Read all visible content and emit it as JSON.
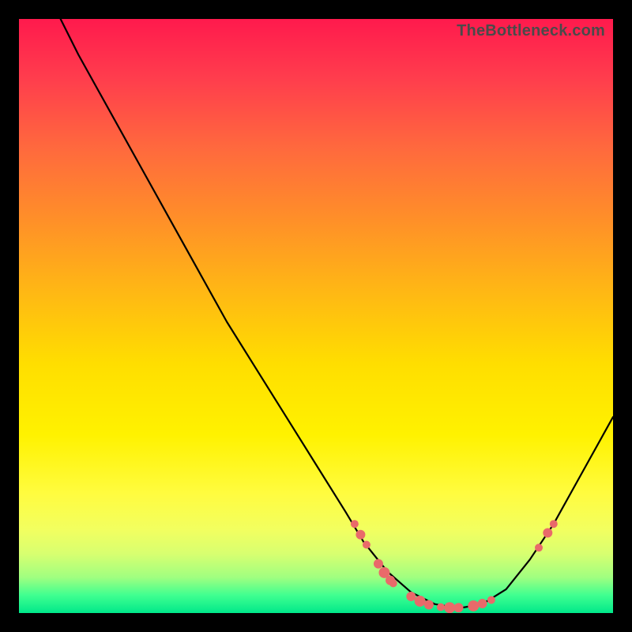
{
  "watermark": "TheBottleneck.com",
  "chart_data": {
    "type": "line",
    "title": "",
    "xlabel": "",
    "ylabel": "",
    "xlim": [
      0,
      100
    ],
    "ylim": [
      0,
      100
    ],
    "grid": false,
    "curve": [
      {
        "x": 7,
        "y": 100
      },
      {
        "x": 10,
        "y": 94
      },
      {
        "x": 15,
        "y": 85
      },
      {
        "x": 20,
        "y": 76
      },
      {
        "x": 25,
        "y": 67
      },
      {
        "x": 30,
        "y": 58
      },
      {
        "x": 35,
        "y": 49
      },
      {
        "x": 40,
        "y": 41
      },
      {
        "x": 45,
        "y": 33
      },
      {
        "x": 50,
        "y": 25
      },
      {
        "x": 55,
        "y": 17
      },
      {
        "x": 58,
        "y": 12
      },
      {
        "x": 62,
        "y": 7
      },
      {
        "x": 66,
        "y": 3.5
      },
      {
        "x": 70,
        "y": 1.5
      },
      {
        "x": 74,
        "y": 0.8
      },
      {
        "x": 78,
        "y": 1.5
      },
      {
        "x": 82,
        "y": 4
      },
      {
        "x": 86,
        "y": 9
      },
      {
        "x": 90,
        "y": 15
      },
      {
        "x": 95,
        "y": 24
      },
      {
        "x": 100,
        "y": 33
      }
    ],
    "markers": [
      {
        "x": 56.5,
        "y": 15.0,
        "r": 5
      },
      {
        "x": 57.5,
        "y": 13.2,
        "r": 6
      },
      {
        "x": 58.5,
        "y": 11.5,
        "r": 5
      },
      {
        "x": 60.5,
        "y": 8.3,
        "r": 6
      },
      {
        "x": 61.5,
        "y": 6.8,
        "r": 7
      },
      {
        "x": 62.5,
        "y": 5.5,
        "r": 6
      },
      {
        "x": 63.0,
        "y": 5.0,
        "r": 5
      },
      {
        "x": 66.0,
        "y": 2.8,
        "r": 6
      },
      {
        "x": 67.5,
        "y": 2.0,
        "r": 7
      },
      {
        "x": 69.0,
        "y": 1.4,
        "r": 6
      },
      {
        "x": 71.0,
        "y": 1.0,
        "r": 5
      },
      {
        "x": 72.5,
        "y": 0.9,
        "r": 7
      },
      {
        "x": 74.0,
        "y": 0.9,
        "r": 6
      },
      {
        "x": 76.5,
        "y": 1.2,
        "r": 7
      },
      {
        "x": 78.0,
        "y": 1.6,
        "r": 6
      },
      {
        "x": 79.5,
        "y": 2.2,
        "r": 5
      },
      {
        "x": 87.5,
        "y": 11.0,
        "r": 5
      },
      {
        "x": 89.0,
        "y": 13.5,
        "r": 6
      },
      {
        "x": 90.0,
        "y": 15.0,
        "r": 5
      }
    ],
    "colors": {
      "curve": "#000000",
      "marker_fill": "#e96a6a",
      "marker_stroke": "#c94f4f"
    }
  }
}
